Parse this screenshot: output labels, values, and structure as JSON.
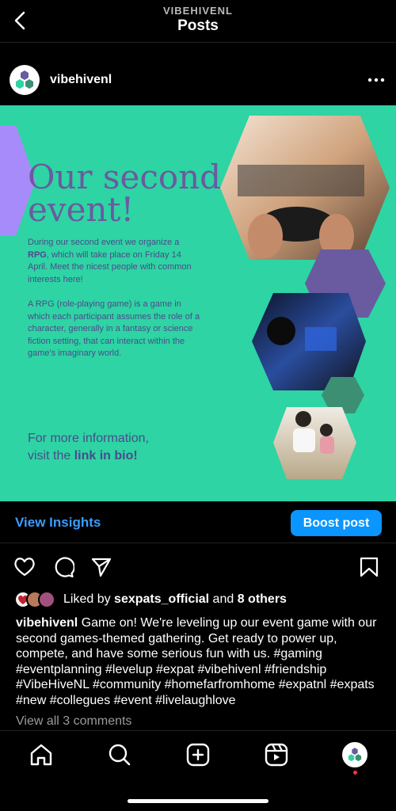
{
  "header": {
    "account": "VIBEHIVENL",
    "title": "Posts"
  },
  "post": {
    "username": "vibehivenl",
    "image": {
      "headline_line1": "Our second",
      "headline_line2": "event!",
      "para1_a": "During our second event we organize a ",
      "para1_bold": "RPG",
      "para1_b": ", which will take place on Friday 14 April. Meet the nicest people with common interests here!",
      "para2": "A RPG (role-playing game) is a game in which each participant assumes the role of a character, generally in a fantasy or science fiction setting, that can interact within the game's imaginary world.",
      "cta_line1": "For more information,",
      "cta_line2_a": "visit the ",
      "cta_line2_bold": "link in bio!",
      "colors": {
        "background": "#2ed4a3",
        "headline": "#6a5aa0",
        "purple_hex": "#6a5aa0",
        "lavender_hex": "#a78bfa",
        "teal_hex": "#3d8f74"
      },
      "photos": [
        "gaming-setup-photo",
        "gamers-arena-photo",
        "father-son-gaming-photo"
      ]
    },
    "insights_label": "View Insights",
    "boost_label": "Boost post",
    "liked_by_prefix": "Liked by ",
    "liked_by_user": "sexpats_official",
    "liked_by_mid": " and ",
    "liked_by_count": "8 others",
    "caption_user": "vibehivenl",
    "caption_text": " Game on! We're leveling up our event game with our second games-themed gathering. Get ready to power up, compete, and have some serious fun with us. #gaming #eventplanning #levelup #expat #vibehivenl #friendship  #VibeHiveNL #community #homefarfromhome #expatnl #expats #new #collegues #event #livelaughlove",
    "view_comments": "View all 3 comments"
  },
  "nav": {
    "items": [
      "home-icon",
      "search-icon",
      "create-icon",
      "reels-icon",
      "profile-avatar"
    ],
    "accent": "#0a95ff",
    "notification_color": "#ff3040"
  }
}
